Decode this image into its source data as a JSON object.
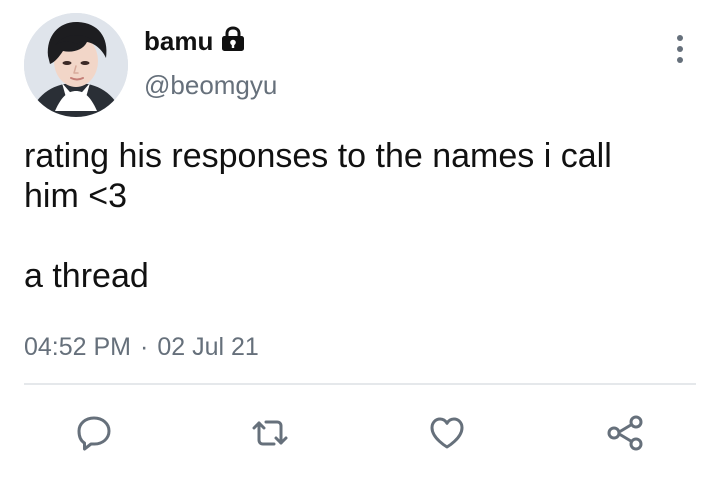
{
  "tweet": {
    "author": {
      "display_name": "bamu",
      "handle": "@beomgyu",
      "protected_icon": "lock-icon",
      "avatar_icon": "profile-photo"
    },
    "text": "rating his responses to the names i call\nhim <3\n\na thread",
    "time": "04:52 PM",
    "separator": "·",
    "date": "02 Jul 21",
    "more_icon": "vertical-dots-icon",
    "actions": [
      {
        "name": "reply",
        "icon": "reply-icon"
      },
      {
        "name": "retweet",
        "icon": "retweet-icon"
      },
      {
        "name": "like",
        "icon": "heart-icon"
      },
      {
        "name": "share",
        "icon": "share-icon"
      }
    ]
  },
  "colors": {
    "text": "#111111",
    "secondary": "#66707b",
    "divider": "#e5e8eb",
    "icons": "#66707b",
    "background": "#ffffff"
  }
}
